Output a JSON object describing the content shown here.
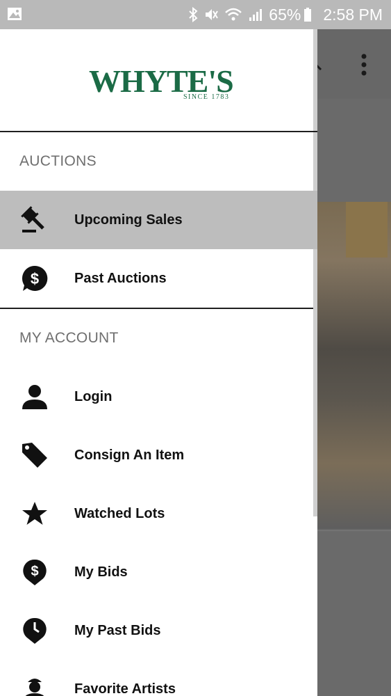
{
  "status_bar": {
    "battery_percent": "65%",
    "time": "2:58 PM"
  },
  "logo": {
    "name": "WHYTE'S",
    "since": "SINCE 1783"
  },
  "auctions_section": {
    "header": "AUCTIONS",
    "items": [
      {
        "label": "Upcoming Sales",
        "icon": "gavel-icon",
        "active": true
      },
      {
        "label": "Past Auctions",
        "icon": "dollar-bubble-icon",
        "active": false
      }
    ]
  },
  "account_section": {
    "header": "MY ACCOUNT",
    "items": [
      {
        "label": "Login",
        "icon": "person-icon"
      },
      {
        "label": "Consign An Item",
        "icon": "tag-icon"
      },
      {
        "label": "Watched Lots",
        "icon": "star-icon"
      },
      {
        "label": "My Bids",
        "icon": "dollar-pin-icon"
      },
      {
        "label": "My Past Bids",
        "icon": "clock-pin-icon"
      },
      {
        "label": "Favorite Artists",
        "icon": "artist-icon"
      }
    ]
  },
  "colors": {
    "brand": "#1b6b46",
    "active_item_bg": "#bdbdbd"
  }
}
